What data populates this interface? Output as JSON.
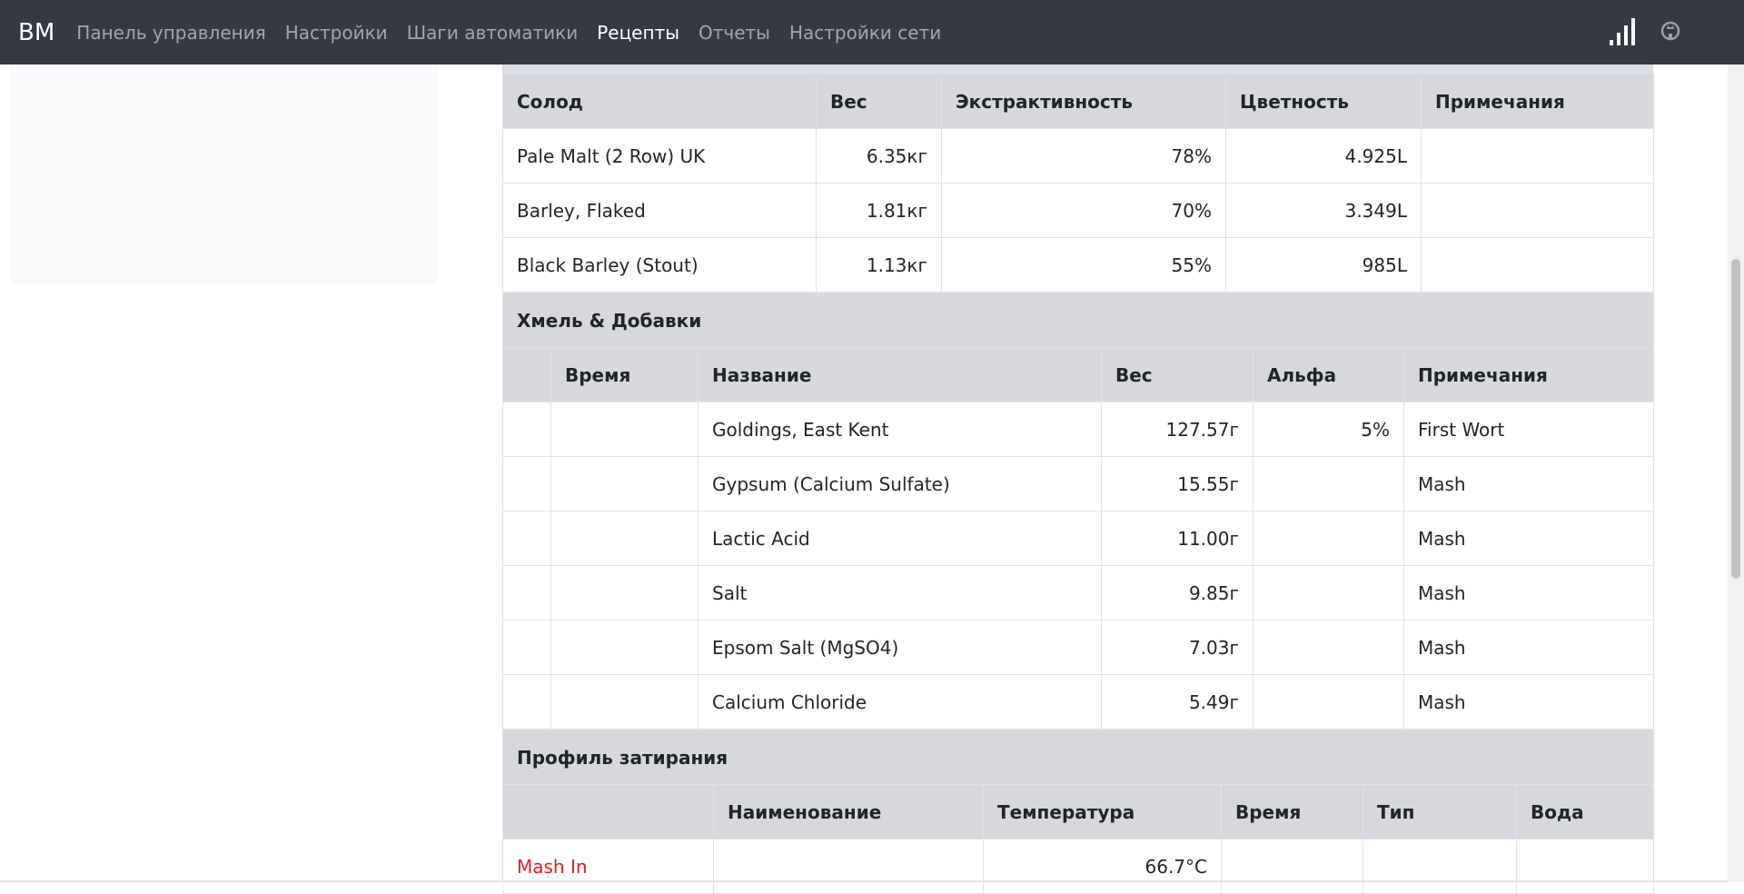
{
  "navbar": {
    "brand": "BM",
    "items": [
      {
        "label": "Панель управления",
        "active": false
      },
      {
        "label": "Настройки",
        "active": false
      },
      {
        "label": "Шаги автоматики",
        "active": false
      },
      {
        "label": "Рецепты",
        "active": true
      },
      {
        "label": "Отчеты",
        "active": false
      },
      {
        "label": "Настройки сети",
        "active": false
      }
    ],
    "icons": [
      "signal-icon",
      "github-icon"
    ]
  },
  "malts": {
    "headers": [
      "Солод",
      "Вес",
      "Экстрактивность",
      "Цветность",
      "Примечания"
    ],
    "rows": [
      [
        "Pale Malt (2 Row) UK",
        "6.35кг",
        "78%",
        "4.925L",
        ""
      ],
      [
        "Barley, Flaked",
        "1.81кг",
        "70%",
        "3.349L",
        ""
      ],
      [
        "Black Barley (Stout)",
        "1.13кг",
        "55%",
        "985L",
        ""
      ]
    ]
  },
  "hops": {
    "title": "Хмель & Добавки",
    "headers": [
      "",
      "Время",
      "Название",
      "Вес",
      "Альфа",
      "Примечания"
    ],
    "rows": [
      [
        "",
        "",
        "Goldings, East Kent",
        "127.57г",
        "5%",
        "First Wort"
      ],
      [
        "",
        "",
        "Gypsum (Calcium Sulfate)",
        "15.55г",
        "",
        "Mash"
      ],
      [
        "",
        "",
        "Lactic Acid",
        "11.00г",
        "",
        "Mash"
      ],
      [
        "",
        "",
        "Salt",
        "9.85г",
        "",
        "Mash"
      ],
      [
        "",
        "",
        "Epsom Salt (MgSO4)",
        "7.03г",
        "",
        "Mash"
      ],
      [
        "",
        "",
        "Calcium Chloride",
        "5.49г",
        "",
        "Mash"
      ]
    ]
  },
  "mash": {
    "title": "Профиль затирания",
    "headers": [
      "",
      "Наименование",
      "Температура",
      "Время",
      "Тип",
      "Вода"
    ],
    "rows": [
      [
        "Mash In",
        "",
        "66.7°C",
        "",
        "",
        ""
      ]
    ]
  },
  "colors": {
    "navbar_bg": "#343a40",
    "header_bg": "#d6d8db",
    "link_red": "#e41c1c"
  }
}
